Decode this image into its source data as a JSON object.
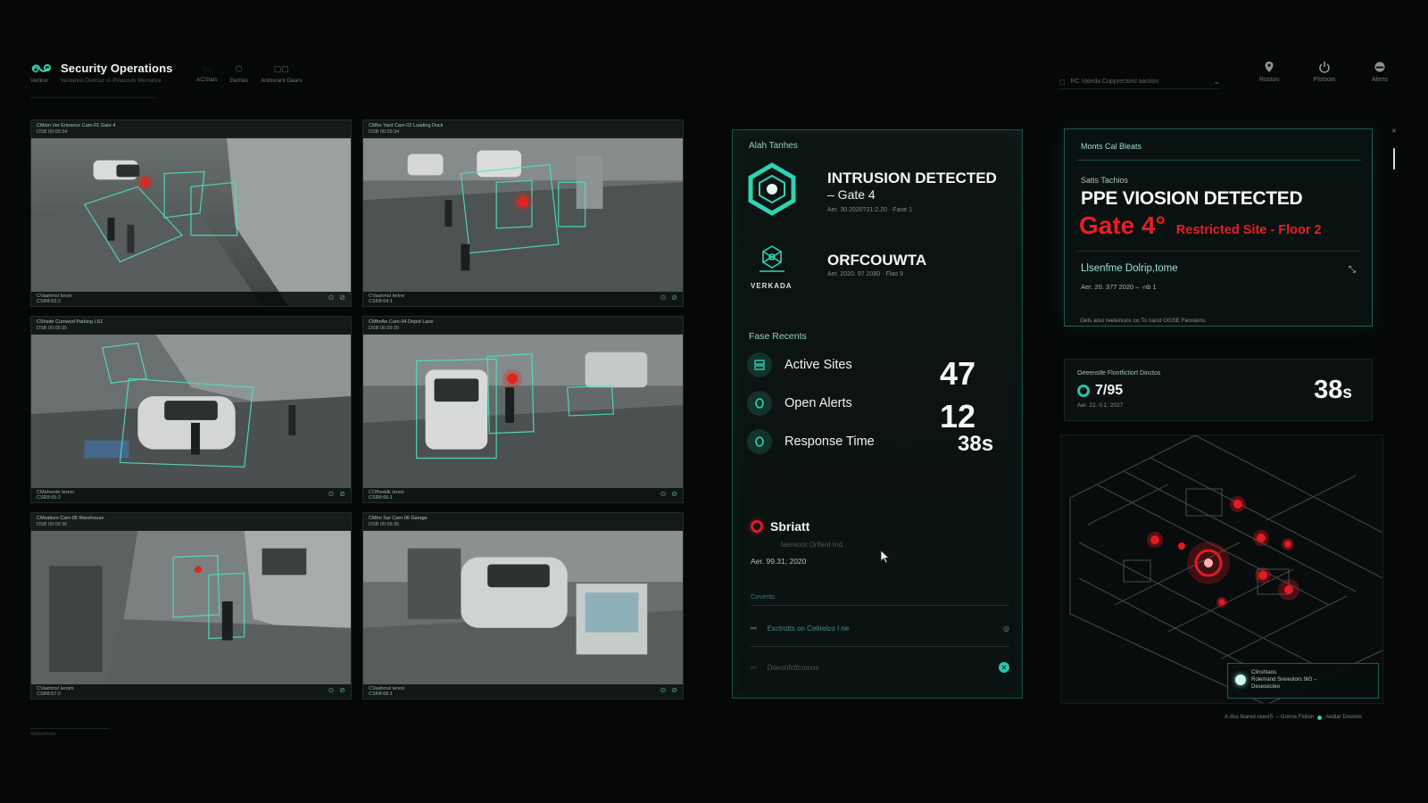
{
  "header": {
    "brand_title": "Security Operations",
    "brand_sub": "Vertkon",
    "brand_desc": "Vardanisk Deteraz vs Pinacouls Wervance",
    "nav_tabs": [
      {
        "icon": "camera-icon",
        "label": "ACStais"
      },
      {
        "icon": "shield-icon",
        "label": "Deritas"
      },
      {
        "icon": "grid-icon",
        "label": "Anibvrant Daars"
      }
    ],
    "site_select_label": "RC Valeda Copprectoisl aaction",
    "top_icons": [
      {
        "icon": "location-pin-icon",
        "label": "Roston"
      },
      {
        "icon": "power-icon",
        "label": "Plstooin"
      },
      {
        "icon": "alert-bell-icon",
        "label": "Alerts"
      }
    ]
  },
  "cameras": [
    {
      "head1": "CMstn Ver Entrance Cam-01 Gate 4",
      "head2": "DSB 00:09:34",
      "foot1": "CVaahmsl Iersin",
      "foot2": "CSR8:63:2"
    },
    {
      "head1": "CMhn Yard Cam-02 Loading Dock",
      "head2": "DSB 00:09:34",
      "foot1": "CVaahmsl Ierine",
      "foot2": "CSR8:64:1"
    },
    {
      "head1": "CShsdn Cumwod Parking LS1",
      "head2": "DSB 00:09:35",
      "foot1": "CMahvodn Ierem",
      "foot2": "CSR8:65:2"
    },
    {
      "head1": "CMhnAn Cam-04 Depot Lane",
      "head2": "DSB 00:09:35",
      "foot1": "COfheddk Iersin",
      "foot2": "CSR8:66:1"
    },
    {
      "head1": "CMsatiurs Cam-05 Warehouse",
      "head2": "DSB 00:09:36",
      "foot1": "CVaahmsl Iersim",
      "foot2": "CSR8:67:2"
    },
    {
      "head1": "CMhn Sar Cam-06 Garage",
      "head2": "DSB 00:09:36",
      "foot1": "CVaahmsl Ieresi",
      "foot2": "CSR8:68:1"
    }
  ],
  "alerts_panel": {
    "title": "Alah Tanhes",
    "alert1": {
      "title": "INTRUSION DETECTED",
      "subtitle": "– Gate 4",
      "meta": "Aer. 30.2020?21:2.20  ·  Faoe 1"
    },
    "alert2": {
      "title": "ORFCOUWTA",
      "logo_text": "VERKADA",
      "meta": "Aer. 2020. 97 2080  ·  Flao 9"
    },
    "metrics_title": "Fase Recents",
    "metrics": [
      {
        "label": "Active Sites",
        "value": "47",
        "icon": "server-icon"
      },
      {
        "label": "Open Alerts",
        "value": "12",
        "icon": "alert-icon"
      },
      {
        "label": "Response Time",
        "value": "38s",
        "icon": "timer-icon"
      }
    ],
    "status": {
      "title": "Sbriatt",
      "sub": "Iaereoot Ortlent Ind",
      "meta": "Aer. 99.31; 2020",
      "section": "Covents",
      "rows": [
        {
          "label": "Exctrotts on Ceitrelco I ne"
        },
        {
          "label": "Doeonfctfcomos"
        }
      ]
    }
  },
  "ppe_panel": {
    "title": "Monts Cal Bleats",
    "sub": "Satis Tachios",
    "heading": "PPE VIOSION DETECTED",
    "gate": "Gate 4°",
    "site": "Restricted Site - Floor 2",
    "item": "Llsenfme Dolrip,tome",
    "item_meta": "Aer. 20. 377 2020 – ·nb 1",
    "footer": "Oels aiso reeterioos co To nand OGSE Feostens"
  },
  "response_panel": {
    "title": "Oeeenstle Flontfictiort Dinctos",
    "value": "7/95",
    "meta": "Aer. 22. 0.1: 2027",
    "big_value": "38",
    "big_unit": "s"
  },
  "map": {
    "legend_line1": "Clinshtaos",
    "legend_line2": "Rolemand Srereotors 9IG –",
    "legend_line3": "Deseoecteo"
  },
  "footer": {
    "note_left": "A diss feared ceeviS  ·–  Gonne Fiolion",
    "note_right": "Aedlar Dovoxis",
    "bottom_left": "Stdnunmoter"
  },
  "colors": {
    "accent": "#2fd3b1",
    "alert": "#ec1c24",
    "background": "#060808"
  }
}
